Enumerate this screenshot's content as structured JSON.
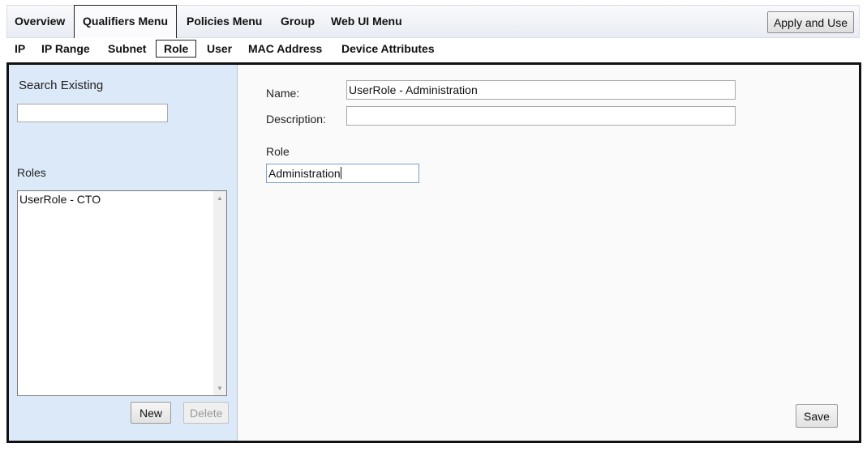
{
  "top_menu": {
    "items": [
      {
        "label": "Overview"
      },
      {
        "label": "Qualifiers Menu",
        "active": true
      },
      {
        "label": "Policies Menu"
      },
      {
        "label": "Group"
      },
      {
        "label": "Web UI Menu"
      }
    ],
    "apply_label": "Apply and Use"
  },
  "sub_menu": {
    "items": [
      {
        "label": "IP"
      },
      {
        "label": "IP Range"
      },
      {
        "label": "Subnet"
      },
      {
        "label": "Role",
        "active": true
      },
      {
        "label": "User"
      },
      {
        "label": "MAC Address"
      },
      {
        "label": "Device Attributes"
      }
    ]
  },
  "left_panel": {
    "search_label": "Search Existing",
    "search_value": "",
    "roles_label": "Roles",
    "roles": [
      "UserRole - CTO"
    ],
    "new_label": "New",
    "delete_label": "Delete"
  },
  "form": {
    "name_label": "Name:",
    "name_value": "UserRole - Administration",
    "description_label": "Description:",
    "description_value": "",
    "role_label": "Role",
    "role_value": "Administration",
    "save_label": "Save"
  },
  "colors": {
    "left_panel_bg": "#dce9f8",
    "frame_border": "#111111"
  }
}
